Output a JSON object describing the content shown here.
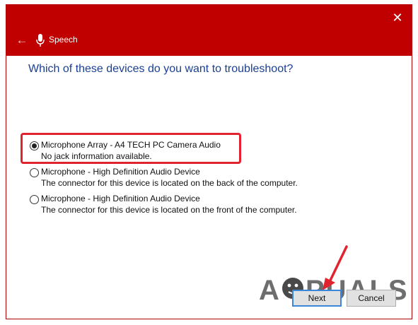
{
  "window": {
    "title": "Speech",
    "close_glyph": "✕",
    "back_glyph": "←"
  },
  "question": "Which of these devices do you want to troubleshoot?",
  "options": [
    {
      "name": "Microphone Array - A4 TECH PC Camera Audio",
      "detail": "No jack information available.",
      "selected": true
    },
    {
      "name": "Microphone - High Definition Audio Device",
      "detail": "The connector for this device is located on the back of the computer.",
      "selected": false
    },
    {
      "name": "Microphone - High Definition Audio Device",
      "detail": "The connector for this device is located on the front of the computer.",
      "selected": false
    }
  ],
  "buttons": {
    "next": "Next",
    "cancel": "Cancel"
  },
  "watermark": "APPUALS",
  "colors": {
    "titlebar": "#c00000",
    "accent_text": "#1b3f93",
    "highlight": "#e0232e",
    "focus": "#3b86d8"
  },
  "icons": {
    "back": "back-arrow-icon",
    "mic": "microphone-icon",
    "close": "close-icon"
  }
}
